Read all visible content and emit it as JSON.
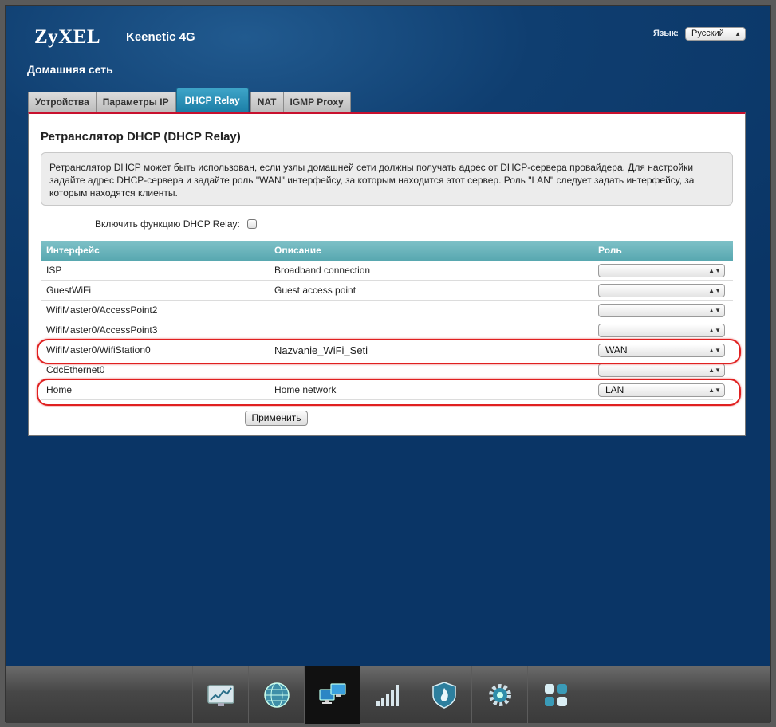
{
  "header": {
    "logo": "ZyXEL",
    "model": "Keenetic 4G",
    "language_label": "Язык:",
    "language_value": "Русский"
  },
  "section_title": "Домашняя сеть",
  "tabs": [
    {
      "label": "Устройства",
      "active": false
    },
    {
      "label": "Параметры IP",
      "active": false
    },
    {
      "label": "DHCP Relay",
      "active": true
    },
    {
      "label": "NAT",
      "active": false
    },
    {
      "label": "IGMP Proxy",
      "active": false
    }
  ],
  "panel": {
    "title": "Ретранслятор DHCP (DHCP Relay)",
    "info_text": "Ретранслятор DHCP может быть использован, если узлы домашней сети должны получать адрес от DHCP-сервера провайдера. Для настройки задайте адрес DHCP-сервера и задайте роль \"WAN\" интерфейсу, за которым находится этот сервер. Роль \"LAN\" следует задать интерфейсу, за которым находятся клиенты.",
    "enable_label": "Включить функцию DHCP Relay:",
    "enable_checked": false,
    "apply_label": "Применить"
  },
  "table": {
    "headers": [
      "Интерфейс",
      "Описание",
      "Роль"
    ],
    "rows": [
      {
        "interface": "ISP",
        "description": "Broadband connection",
        "role": ""
      },
      {
        "interface": "GuestWiFi",
        "description": "Guest access point",
        "role": ""
      },
      {
        "interface": "WifiMaster0/AccessPoint2",
        "description": "",
        "role": ""
      },
      {
        "interface": "WifiMaster0/AccessPoint3",
        "description": "",
        "role": ""
      },
      {
        "interface": "WifiMaster0/WifiStation0",
        "description": "Nazvanie_WiFi_Seti",
        "role": "WAN"
      },
      {
        "interface": "CdcEthernet0",
        "description": "",
        "role": ""
      },
      {
        "interface": "Home",
        "description": "Home network",
        "role": "LAN"
      }
    ]
  },
  "dock": {
    "items": [
      {
        "icon": "monitor-chart-icon",
        "active": false
      },
      {
        "icon": "globe-icon",
        "active": false
      },
      {
        "icon": "network-computers-icon",
        "active": true
      },
      {
        "icon": "signal-bars-icon",
        "active": false
      },
      {
        "icon": "shield-flame-icon",
        "active": false
      },
      {
        "icon": "gear-icon",
        "active": false
      },
      {
        "icon": "apps-grid-icon",
        "active": false
      }
    ]
  },
  "colors": {
    "background": "#0f3e70",
    "tab_active": "#1c7fa7",
    "table_header": "#6bb5bc",
    "panel_accent": "#c8102e",
    "annotation": "#e02020"
  }
}
